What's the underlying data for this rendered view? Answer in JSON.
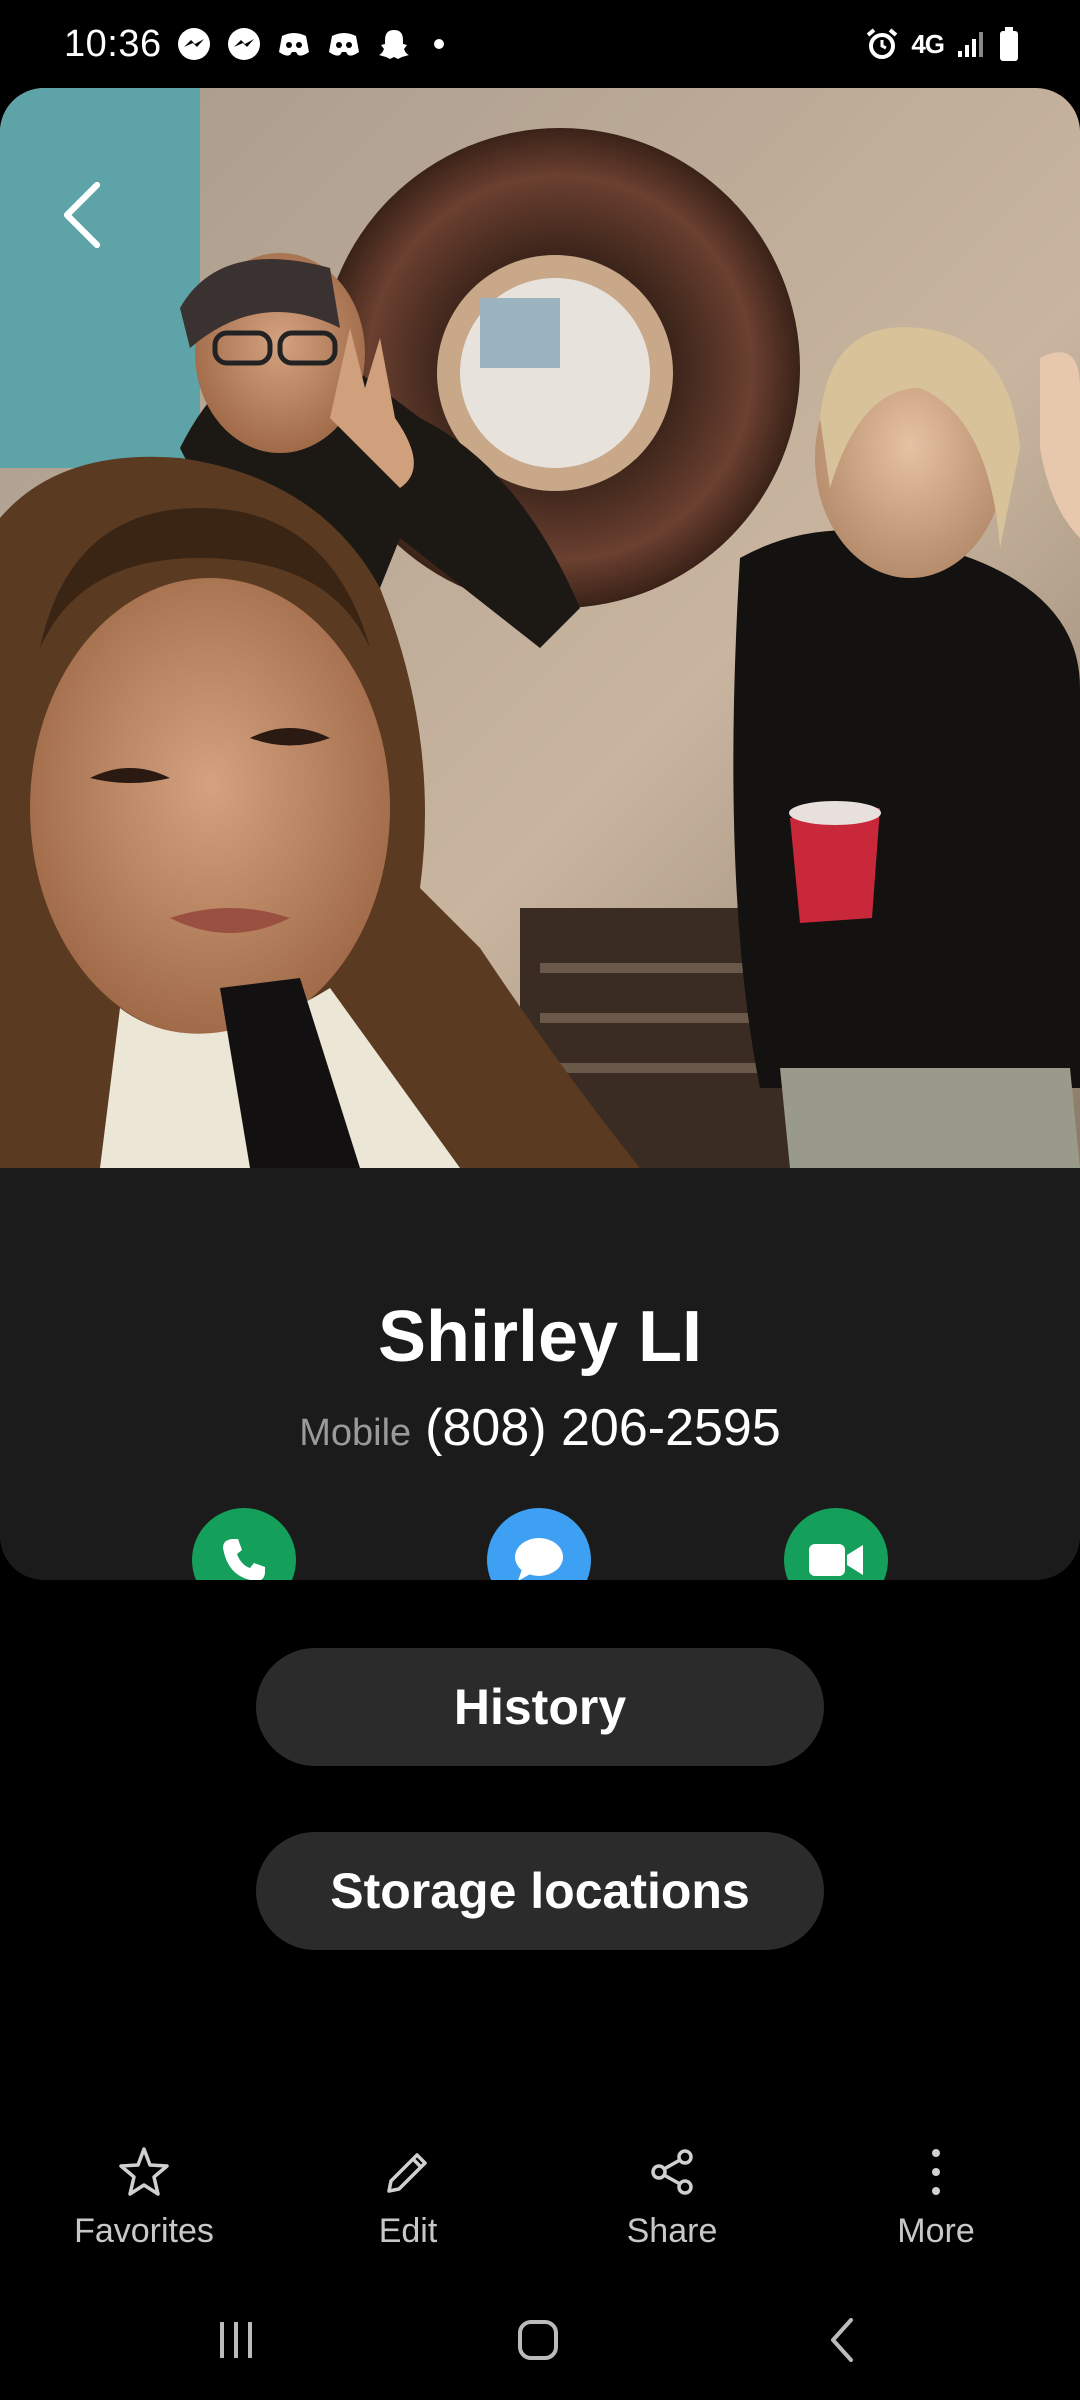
{
  "status_bar": {
    "time": "10:36",
    "network": "4G",
    "notification_icons": [
      "messenger-icon",
      "messenger-icon",
      "discord-icon",
      "discord-icon",
      "snapchat-icon"
    ],
    "system_icons": [
      "alarm-icon",
      "signal-icon",
      "battery-icon"
    ]
  },
  "contact": {
    "name": "Shirley LI",
    "phone_type": "Mobile",
    "phone_number": "(808) 206-2595"
  },
  "actions": {
    "call_icon": "phone-icon",
    "message_icon": "chat-icon",
    "video_icon": "video-camera-icon",
    "call_color": "#14a05a",
    "message_color": "#3ea0f2",
    "video_color": "#14a05a"
  },
  "buttons": {
    "history": "History",
    "storage": "Storage locations"
  },
  "toolbar": {
    "favorites": "Favorites",
    "edit": "Edit",
    "share": "Share",
    "more": "More"
  },
  "nav": [
    "recents-icon",
    "home-icon",
    "back-icon"
  ]
}
